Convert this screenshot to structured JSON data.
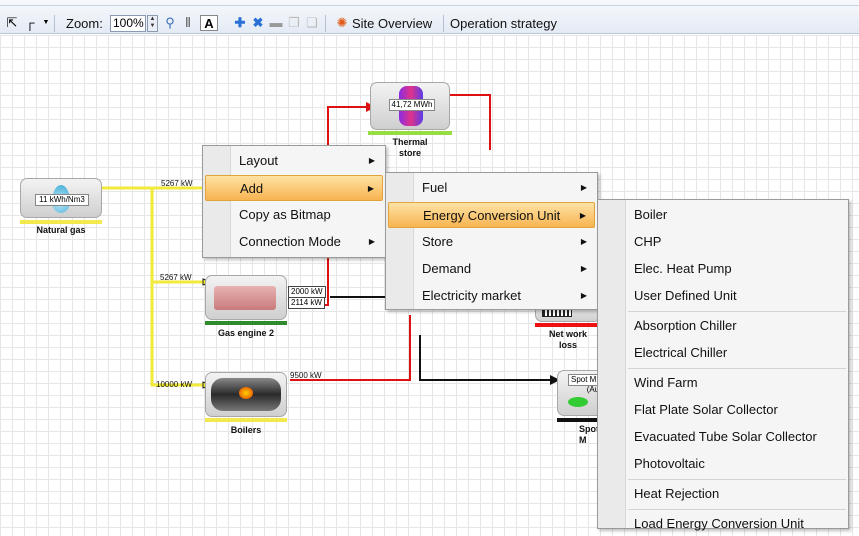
{
  "toolbar": {
    "zoom_label": "Zoom:",
    "zoom_value": "100%",
    "site_overview": "Site Overview",
    "operation_strategy": "Operation strategy"
  },
  "nodes": {
    "natural_gas": {
      "name": "Natural gas",
      "value": "11 kWh/Nm3",
      "bar_color": "#f2e94e"
    },
    "thermal_store": {
      "name": "Thermal\nstore",
      "value": "41,72 MWh",
      "bar_color": "#99dd44"
    },
    "gas_engine": {
      "name": "Gas engine 2",
      "bar_color": "#2e8b2e"
    },
    "boilers": {
      "name": "Boilers",
      "bar_color": "#f2e94e"
    },
    "net_work_loss": {
      "name": "Net work\nloss",
      "bar_color": "#e11"
    },
    "spot_market": {
      "name": "Spot M",
      "value_line1": "Spot M",
      "value_line2": "(Au",
      "bar_color": "#111"
    }
  },
  "flows": {
    "ng_out": "5267 kW",
    "ge_in": "5267 kW",
    "ge_out1": "2000 kW",
    "ge_out2": "2114 kW",
    "boiler_in": "10000 kW",
    "boiler_out": "9500 kW"
  },
  "menu1": {
    "items": [
      {
        "label": "Layout",
        "submenu": true
      },
      {
        "label": "Add",
        "submenu": true,
        "highlighted": true
      },
      {
        "label": "Copy as Bitmap",
        "submenu": false
      },
      {
        "label": "Connection Mode",
        "submenu": true
      }
    ]
  },
  "menu2": {
    "items": [
      {
        "label": "Fuel",
        "submenu": true
      },
      {
        "label": "Energy Conversion Unit",
        "submenu": true,
        "highlighted": true
      },
      {
        "label": "Store",
        "submenu": true
      },
      {
        "label": "Demand",
        "submenu": true
      },
      {
        "label": "Electricity market",
        "submenu": true
      }
    ]
  },
  "menu3": {
    "items": [
      {
        "label": "Boiler"
      },
      {
        "label": "CHP"
      },
      {
        "label": "Elec. Heat Pump"
      },
      {
        "label": "User Defined Unit"
      },
      {
        "label": "Absorption Chiller"
      },
      {
        "label": "Electrical Chiller"
      },
      {
        "label": "Wind Farm"
      },
      {
        "label": "Flat Plate Solar Collector"
      },
      {
        "label": "Evacuated Tube Solar Collector"
      },
      {
        "label": "Photovoltaic"
      },
      {
        "label": "Heat Rejection"
      },
      {
        "label": "Load Energy Conversion Unit"
      }
    ]
  },
  "colors": {
    "heat_flow": "#dd1111",
    "fuel_flow": "#f2ea3a",
    "elec_flow": "#111111",
    "menu_highlight": "#f8b451"
  }
}
